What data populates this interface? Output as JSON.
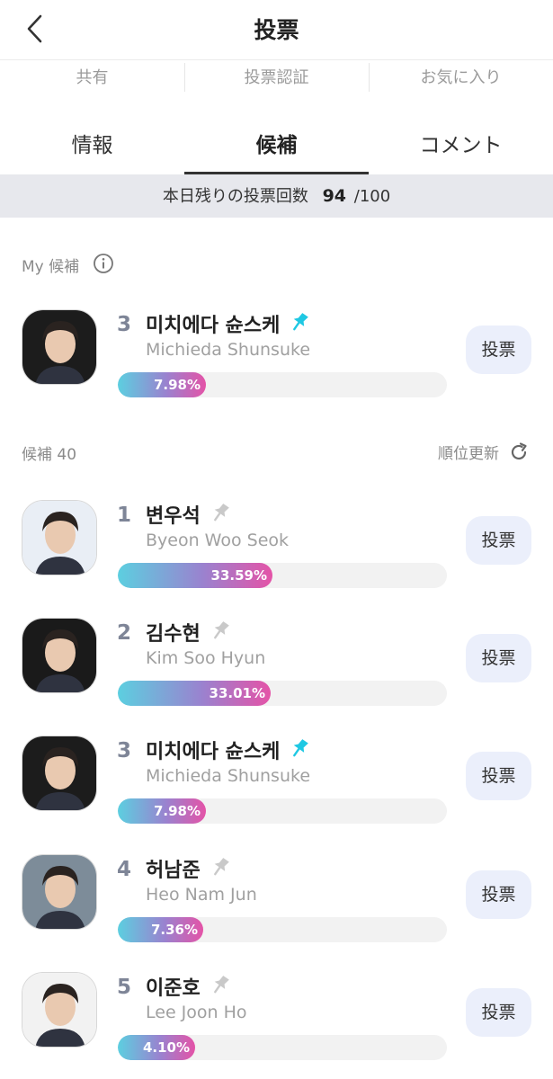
{
  "header": {
    "title": "投票"
  },
  "subtabs": [
    "共有",
    "投票認証",
    "お気に入り"
  ],
  "tabs": [
    "情報",
    "候補",
    "コメント"
  ],
  "votes": {
    "label": "本日残りの投票回数",
    "remaining": "94",
    "total": "/100"
  },
  "my_section": {
    "label": "My 候補"
  },
  "candidates_section": {
    "label": "候補 40",
    "refresh_label": "順位更新"
  },
  "vote_button_label": "投票",
  "colors": {
    "pin_active": "#1fc8e3",
    "pin_inactive": "#c9c9c9",
    "bar_gradient": [
      "#5ccfe0",
      "#9a82cf",
      "#e453a7"
    ],
    "vote_button_bg": "#ebeffb"
  },
  "my_candidate": {
    "rank": "3",
    "name": "미치에다 슌스케",
    "name_en": "Michieda Shunsuke",
    "percent": 7.98,
    "percent_label": "7.98",
    "pinned": true
  },
  "candidates": [
    {
      "rank": "1",
      "name": "변우석",
      "name_en": "Byeon Woo Seok",
      "percent": 33.59,
      "percent_label": "33.59",
      "pinned": false
    },
    {
      "rank": "2",
      "name": "김수현",
      "name_en": "Kim Soo Hyun",
      "percent": 33.01,
      "percent_label": "33.01",
      "pinned": false
    },
    {
      "rank": "3",
      "name": "미치에다 슌스케",
      "name_en": "Michieda Shunsuke",
      "percent": 7.98,
      "percent_label": "7.98",
      "pinned": true
    },
    {
      "rank": "4",
      "name": "허남준",
      "name_en": "Heo Nam Jun",
      "percent": 7.36,
      "percent_label": "7.36",
      "pinned": false
    },
    {
      "rank": "5",
      "name": "이준호",
      "name_en": "Lee Joon Ho",
      "percent": 4.1,
      "percent_label": "4.10",
      "pinned": false
    }
  ]
}
